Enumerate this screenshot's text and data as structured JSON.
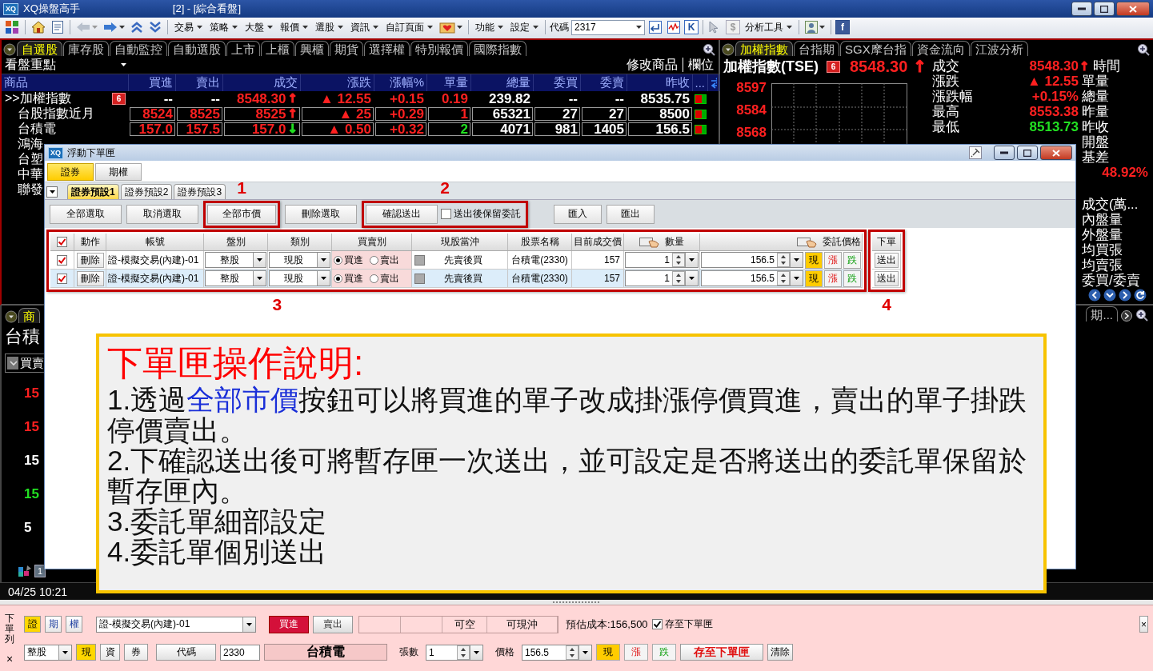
{
  "window": {
    "logo": "XQ",
    "title": "XQ操盤高手",
    "subtitle": "[2] - [綜合看盤]"
  },
  "toolbar": {
    "menus": [
      {
        "label": "交易"
      },
      {
        "label": "策略"
      },
      {
        "label": "大盤"
      },
      {
        "label": "報價"
      },
      {
        "label": "選股"
      },
      {
        "label": "資訊"
      },
      {
        "label": "自訂頁面"
      }
    ],
    "menus2": [
      {
        "label": "功能"
      },
      {
        "label": "設定"
      }
    ],
    "code_label": "代碼",
    "code_value": "2317",
    "k_button": "K",
    "dollar_button": "$",
    "analysis_menu": "分析工具",
    "social_button": "f"
  },
  "watchlist": {
    "tabs": [
      {
        "label": "自選股",
        "selected": true
      },
      {
        "label": "庫存股",
        "selected": false
      },
      {
        "label": "自動監控",
        "selected": false
      },
      {
        "label": "自動選股",
        "selected": false
      },
      {
        "label": "上市",
        "selected": false
      },
      {
        "label": "上櫃",
        "selected": false
      },
      {
        "label": "興櫃",
        "selected": false
      },
      {
        "label": "期貨",
        "selected": false
      },
      {
        "label": "選擇權",
        "selected": false
      },
      {
        "label": "特別報價",
        "selected": false
      },
      {
        "label": "國際指數",
        "selected": false
      }
    ],
    "group": "看盤重點",
    "actions": [
      "修改商品",
      "欄位"
    ],
    "columns": [
      "商品",
      "買進",
      "賣出",
      "成交",
      "漲跌",
      "漲幅%",
      "單量",
      "總量",
      "委買",
      "委賣",
      "昨收",
      "..."
    ],
    "rows": [
      {
        "name": ">>加權指數",
        "badge": "6",
        "boxed": false,
        "cells": [
          {
            "text": "--",
            "color": "#ffffff"
          },
          {
            "text": "--",
            "color": "#ffffff"
          },
          {
            "text": "8548.30",
            "color": "#ff2020",
            "arrow": {
              "text": "↑",
              "color": "#ff2020"
            }
          },
          {
            "text": "▲ 12.55",
            "color": "#ff2020"
          },
          {
            "text": "+0.15",
            "color": "#ff2020"
          },
          {
            "text": "0.19",
            "color": "#ff2020"
          },
          {
            "text": "239.82",
            "color": "#ffffff"
          },
          {
            "text": "--",
            "color": "#ffffff"
          },
          {
            "text": "--",
            "color": "#ffffff"
          },
          {
            "text": "8535.75",
            "color": "#ffffff"
          }
        ]
      },
      {
        "name": "台股指數近月",
        "boxed": true,
        "cells": [
          {
            "text": "8524",
            "color": "#ff2020"
          },
          {
            "text": "8525",
            "color": "#ff2020"
          },
          {
            "text": "8525",
            "color": "#ff2020",
            "arrow": {
              "text": "↑",
              "color": "#ff2020"
            }
          },
          {
            "text": "▲ 25",
            "color": "#ff2020"
          },
          {
            "text": "+0.29",
            "color": "#ff2020"
          },
          {
            "text": "1",
            "color": "#ff2020"
          },
          {
            "text": "65321",
            "color": "#ffffff"
          },
          {
            "text": "27",
            "color": "#ffffff"
          },
          {
            "text": "27",
            "color": "#ffffff"
          },
          {
            "text": "8500",
            "color": "#ffffff"
          }
        ]
      },
      {
        "name": "台積電",
        "boxed": true,
        "cells": [
          {
            "text": "157.0",
            "color": "#ff2020"
          },
          {
            "text": "157.5",
            "color": "#ff2020"
          },
          {
            "text": "157.0",
            "color": "#ff2020",
            "arrow": {
              "text": "↓",
              "color": "#22e022"
            }
          },
          {
            "text": "▲ 0.50",
            "color": "#ff2020"
          },
          {
            "text": "+0.32",
            "color": "#ff2020"
          },
          {
            "text": "2",
            "color": "#22e022"
          },
          {
            "text": "4071",
            "color": "#ffffff"
          },
          {
            "text": "981",
            "color": "#ffffff"
          },
          {
            "text": "1405",
            "color": "#ffffff"
          },
          {
            "text": "156.5",
            "color": "#ffffff"
          }
        ]
      },
      {
        "name": "鴻海"
      },
      {
        "name": "台塑"
      },
      {
        "name": "中華"
      },
      {
        "name": "聯發"
      }
    ]
  },
  "detail_panel": {
    "tab": {
      "label": "商",
      "selected": true
    },
    "title": "台積",
    "selector": "買賣",
    "prices": [
      {
        "text": "15",
        "color": "#ff2020"
      },
      {
        "text": "15",
        "color": "#ff2020"
      },
      {
        "text": "15",
        "color": "#ffffff"
      },
      {
        "text": "15",
        "color": "#22e022"
      },
      {
        "text": "5",
        "color": "#ffffff"
      }
    ],
    "page": "1"
  },
  "index_panel": {
    "tabs": [
      {
        "label": "加權指數",
        "selected": true
      },
      {
        "label": "台指期",
        "selected": false
      },
      {
        "label": "SGX摩台指",
        "selected": false
      },
      {
        "label": "資金流向",
        "selected": false
      },
      {
        "label": "江波分析",
        "selected": false
      }
    ],
    "title": "加權指數(TSE)",
    "badge": "6",
    "price": "8548.30",
    "price_arrow": "↑",
    "axis_labels": [
      "8597",
      "8584",
      "8568"
    ],
    "stats": [
      {
        "label": "成交",
        "value": "8548.30",
        "color": "#ff2020",
        "arrow": "↑"
      },
      {
        "label": "漲跌",
        "value": "▲ 12.55",
        "color": "#ff2020"
      },
      {
        "label": "漲跌幅",
        "value": "+0.15%",
        "color": "#ff2020"
      },
      {
        "label": "最高",
        "value": "8553.38",
        "color": "#ff2020"
      },
      {
        "label": "最低",
        "value": "8513.73",
        "color": "#22e022"
      }
    ],
    "side_labels": [
      "時間",
      "單量",
      "總量",
      "昨量",
      "昨收",
      "開盤",
      "基差"
    ],
    "ratio": "48.92%",
    "detail_labels": [
      "成交(萬...",
      "內盤量",
      "外盤量",
      "均買張",
      "均賣張",
      "委買/委賣"
    ],
    "lower_tab": "期..."
  },
  "status_bar": {
    "time": "04/25 10:21"
  },
  "order_box": {
    "logo": "XQ",
    "title": "浮動下單匣",
    "market_tabs": [
      {
        "label": "證券",
        "selected": true
      },
      {
        "label": "期權",
        "selected": false
      }
    ],
    "preset_tabs": [
      {
        "label": "證券預設1",
        "selected": true
      },
      {
        "label": "證券預設2",
        "selected": false
      },
      {
        "label": "證券預設3",
        "selected": false
      }
    ],
    "buttons": [
      {
        "label": "全部選取"
      },
      {
        "label": "取消選取"
      },
      {
        "label": "全部市價",
        "callout": "1"
      },
      {
        "label": "刪除選取"
      }
    ],
    "confirm": {
      "label": "確認送出",
      "keep_label": "送出後保留委託",
      "keep_checked": false,
      "callout": "2"
    },
    "io_buttons": [
      {
        "label": "匯入"
      },
      {
        "label": "匯出"
      }
    ],
    "select_all_checked": true,
    "columns": [
      "動作",
      "帳號",
      "盤別",
      "類別",
      "買賣別",
      "現股當沖",
      "股票名稱",
      "目前成交價",
      "數量",
      "委託價格"
    ],
    "send_column": "下單",
    "grid_callout": "3",
    "send_callout": "4",
    "orders": [
      {
        "checked": true,
        "selected": false,
        "action": "刪除",
        "account": "證-模擬交易(內建)-01",
        "board": "整股",
        "type": "現股",
        "sides": [
          {
            "label": "買進",
            "selected": true
          },
          {
            "label": "賣出",
            "selected": false
          }
        ],
        "daytrade_checked": false,
        "daytrade": "先賣後買",
        "stock": "台積電(2330)",
        "last": "157",
        "qty": "1",
        "price": "156.5",
        "price_buttons": [
          {
            "label": "現",
            "kind": "current"
          },
          {
            "label": "漲",
            "kind": "limit_up"
          },
          {
            "label": "跌",
            "kind": "limit_down"
          }
        ],
        "send": "送出"
      },
      {
        "checked": true,
        "selected": true,
        "action": "刪除",
        "account": "證-模擬交易(內建)-01",
        "board": "整股",
        "type": "現股",
        "sides": [
          {
            "label": "買進",
            "selected": true
          },
          {
            "label": "賣出",
            "selected": false
          }
        ],
        "daytrade_checked": false,
        "daytrade": "先賣後買",
        "stock": "台積電(2330)",
        "last": "157",
        "qty": "1",
        "price": "156.5",
        "price_buttons": [
          {
            "label": "現",
            "kind": "current"
          },
          {
            "label": "漲",
            "kind": "limit_up"
          },
          {
            "label": "跌",
            "kind": "limit_down"
          }
        ],
        "send": "送出"
      }
    ]
  },
  "instructions": {
    "title": "下單匣操作說明:",
    "items": [
      {
        "segments": [
          {
            "text": "1.透過",
            "kind": "plain"
          },
          {
            "text": "全部市價",
            "kind": "term"
          },
          {
            "text": "按鈕可以將買進的單子改成掛漲停價買進，賣出的單子掛跌停價賣出。",
            "kind": "plain"
          }
        ]
      },
      {
        "segments": [
          {
            "text": "2.下確認送出後可將暫存匣一次送出，並可設定是否將送出的委託單保留於暫存匣內。",
            "kind": "plain"
          }
        ]
      },
      {
        "segments": [
          {
            "text": "3.委託單細部設定",
            "kind": "plain"
          }
        ]
      },
      {
        "segments": [
          {
            "text": "4.委託單個別送出",
            "kind": "plain"
          }
        ]
      }
    ]
  },
  "order_bar": {
    "label": "下單列",
    "close": "×",
    "corner_close": "×",
    "market_tabs": [
      {
        "label": "證",
        "selected": true
      },
      {
        "label": "期",
        "selected": false
      },
      {
        "label": "權",
        "selected": false
      }
    ],
    "account": "證-模擬交易(內建)-01",
    "sides": [
      {
        "label": "買進",
        "selected": true
      },
      {
        "label": "賣出",
        "selected": false
      }
    ],
    "short_label": "可空",
    "daytrade_label": "可現沖",
    "cost": "預估成本:156,500",
    "save_checked": true,
    "save_label": "存至下單匣",
    "board": "整股",
    "credit_tabs": [
      {
        "label": "現",
        "selected": true
      },
      {
        "label": "資",
        "selected": false
      },
      {
        "label": "券",
        "selected": false
      }
    ],
    "code_button": "代碼",
    "code": "2330",
    "stock_name": "台積電",
    "qty_label": "張數",
    "qty": "1",
    "price_label": "價格",
    "price": "156.5",
    "price_buttons": [
      {
        "label": "現",
        "kind": "current"
      },
      {
        "label": "漲",
        "kind": "limit_up"
      },
      {
        "label": "跌",
        "kind": "limit_down"
      }
    ],
    "save_button": "存至下單匣",
    "clear_button": "清除"
  }
}
